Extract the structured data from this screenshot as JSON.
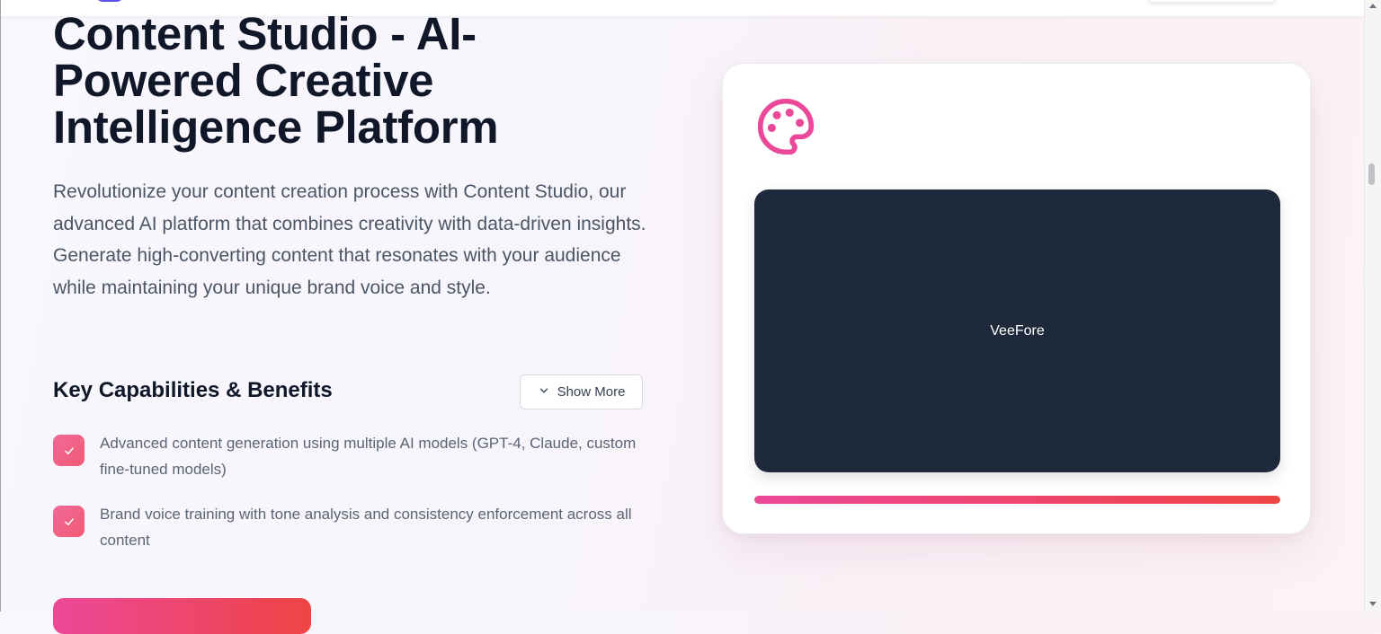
{
  "page": {
    "title": "Content Studio - AI-Powered Creative Intelligence Platform",
    "description": "Revolutionize your content creation process with Content Studio, our advanced AI platform that combines creativity with data-driven insights. Generate high-converting content that resonates with your audience while maintaining your unique brand voice and style."
  },
  "capabilities": {
    "heading": "Key Capabilities & Benefits",
    "show_more_label": "Show More",
    "items": [
      {
        "text": "Advanced content generation using multiple AI models (GPT-4, Claude, custom fine-tuned models)"
      },
      {
        "text": "Brand voice training with tone analysis and consistency enforcement across all content"
      }
    ]
  },
  "preview_card": {
    "icon": "palette-icon",
    "preview_label": "VeeFore",
    "progress_fraction": 1.0
  },
  "colors": {
    "accent_pink": "#ec4899",
    "accent_red": "#ef4444",
    "preview_bg": "#1e293b",
    "heading": "#0f1729"
  }
}
